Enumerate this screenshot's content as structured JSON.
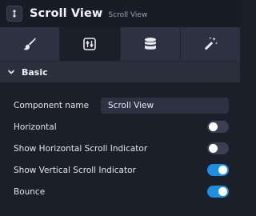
{
  "header": {
    "icon": "scroll-view-icon",
    "title": "Scroll View",
    "subtitle": "Scroll View"
  },
  "tabs": [
    {
      "icon": "brush-icon",
      "active": false
    },
    {
      "icon": "sliders-icon",
      "active": true
    },
    {
      "icon": "database-icon",
      "active": false
    },
    {
      "icon": "magic-wand-icon",
      "active": false
    }
  ],
  "section": {
    "label": "Basic",
    "expanded": true
  },
  "fields": {
    "component_name_label": "Component name",
    "component_name_value": "Scroll View",
    "horizontal_label": "Horizontal",
    "horizontal_on": false,
    "show_horizontal_indicator_label": "Show Horizontal Scroll Indicator",
    "show_horizontal_indicator_on": false,
    "show_vertical_indicator_label": "Show Vertical Scroll Indicator",
    "show_vertical_indicator_on": true,
    "bounce_label": "Bounce",
    "bounce_on": true
  },
  "colors": {
    "accent": "#1d8fe3",
    "background": "#1b1f2a",
    "tab_bar": "#2c3242"
  }
}
